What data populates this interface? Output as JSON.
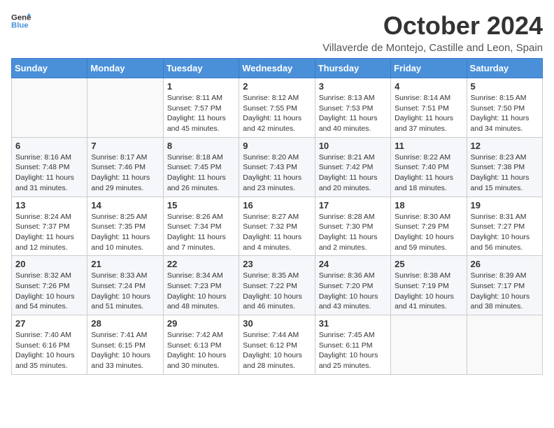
{
  "header": {
    "logo_line1": "General",
    "logo_line2": "Blue",
    "month_year": "October 2024",
    "location": "Villaverde de Montejo, Castille and Leon, Spain"
  },
  "weekdays": [
    "Sunday",
    "Monday",
    "Tuesday",
    "Wednesday",
    "Thursday",
    "Friday",
    "Saturday"
  ],
  "weeks": [
    [
      {
        "day": null,
        "info": ""
      },
      {
        "day": null,
        "info": ""
      },
      {
        "day": "1",
        "info": "Sunrise: 8:11 AM\nSunset: 7:57 PM\nDaylight: 11 hours and 45 minutes."
      },
      {
        "day": "2",
        "info": "Sunrise: 8:12 AM\nSunset: 7:55 PM\nDaylight: 11 hours and 42 minutes."
      },
      {
        "day": "3",
        "info": "Sunrise: 8:13 AM\nSunset: 7:53 PM\nDaylight: 11 hours and 40 minutes."
      },
      {
        "day": "4",
        "info": "Sunrise: 8:14 AM\nSunset: 7:51 PM\nDaylight: 11 hours and 37 minutes."
      },
      {
        "day": "5",
        "info": "Sunrise: 8:15 AM\nSunset: 7:50 PM\nDaylight: 11 hours and 34 minutes."
      }
    ],
    [
      {
        "day": "6",
        "info": "Sunrise: 8:16 AM\nSunset: 7:48 PM\nDaylight: 11 hours and 31 minutes."
      },
      {
        "day": "7",
        "info": "Sunrise: 8:17 AM\nSunset: 7:46 PM\nDaylight: 11 hours and 29 minutes."
      },
      {
        "day": "8",
        "info": "Sunrise: 8:18 AM\nSunset: 7:45 PM\nDaylight: 11 hours and 26 minutes."
      },
      {
        "day": "9",
        "info": "Sunrise: 8:20 AM\nSunset: 7:43 PM\nDaylight: 11 hours and 23 minutes."
      },
      {
        "day": "10",
        "info": "Sunrise: 8:21 AM\nSunset: 7:42 PM\nDaylight: 11 hours and 20 minutes."
      },
      {
        "day": "11",
        "info": "Sunrise: 8:22 AM\nSunset: 7:40 PM\nDaylight: 11 hours and 18 minutes."
      },
      {
        "day": "12",
        "info": "Sunrise: 8:23 AM\nSunset: 7:38 PM\nDaylight: 11 hours and 15 minutes."
      }
    ],
    [
      {
        "day": "13",
        "info": "Sunrise: 8:24 AM\nSunset: 7:37 PM\nDaylight: 11 hours and 12 minutes."
      },
      {
        "day": "14",
        "info": "Sunrise: 8:25 AM\nSunset: 7:35 PM\nDaylight: 11 hours and 10 minutes."
      },
      {
        "day": "15",
        "info": "Sunrise: 8:26 AM\nSunset: 7:34 PM\nDaylight: 11 hours and 7 minutes."
      },
      {
        "day": "16",
        "info": "Sunrise: 8:27 AM\nSunset: 7:32 PM\nDaylight: 11 hours and 4 minutes."
      },
      {
        "day": "17",
        "info": "Sunrise: 8:28 AM\nSunset: 7:30 PM\nDaylight: 11 hours and 2 minutes."
      },
      {
        "day": "18",
        "info": "Sunrise: 8:30 AM\nSunset: 7:29 PM\nDaylight: 10 hours and 59 minutes."
      },
      {
        "day": "19",
        "info": "Sunrise: 8:31 AM\nSunset: 7:27 PM\nDaylight: 10 hours and 56 minutes."
      }
    ],
    [
      {
        "day": "20",
        "info": "Sunrise: 8:32 AM\nSunset: 7:26 PM\nDaylight: 10 hours and 54 minutes."
      },
      {
        "day": "21",
        "info": "Sunrise: 8:33 AM\nSunset: 7:24 PM\nDaylight: 10 hours and 51 minutes."
      },
      {
        "day": "22",
        "info": "Sunrise: 8:34 AM\nSunset: 7:23 PM\nDaylight: 10 hours and 48 minutes."
      },
      {
        "day": "23",
        "info": "Sunrise: 8:35 AM\nSunset: 7:22 PM\nDaylight: 10 hours and 46 minutes."
      },
      {
        "day": "24",
        "info": "Sunrise: 8:36 AM\nSunset: 7:20 PM\nDaylight: 10 hours and 43 minutes."
      },
      {
        "day": "25",
        "info": "Sunrise: 8:38 AM\nSunset: 7:19 PM\nDaylight: 10 hours and 41 minutes."
      },
      {
        "day": "26",
        "info": "Sunrise: 8:39 AM\nSunset: 7:17 PM\nDaylight: 10 hours and 38 minutes."
      }
    ],
    [
      {
        "day": "27",
        "info": "Sunrise: 7:40 AM\nSunset: 6:16 PM\nDaylight: 10 hours and 35 minutes."
      },
      {
        "day": "28",
        "info": "Sunrise: 7:41 AM\nSunset: 6:15 PM\nDaylight: 10 hours and 33 minutes."
      },
      {
        "day": "29",
        "info": "Sunrise: 7:42 AM\nSunset: 6:13 PM\nDaylight: 10 hours and 30 minutes."
      },
      {
        "day": "30",
        "info": "Sunrise: 7:44 AM\nSunset: 6:12 PM\nDaylight: 10 hours and 28 minutes."
      },
      {
        "day": "31",
        "info": "Sunrise: 7:45 AM\nSunset: 6:11 PM\nDaylight: 10 hours and 25 minutes."
      },
      {
        "day": null,
        "info": ""
      },
      {
        "day": null,
        "info": ""
      }
    ]
  ]
}
